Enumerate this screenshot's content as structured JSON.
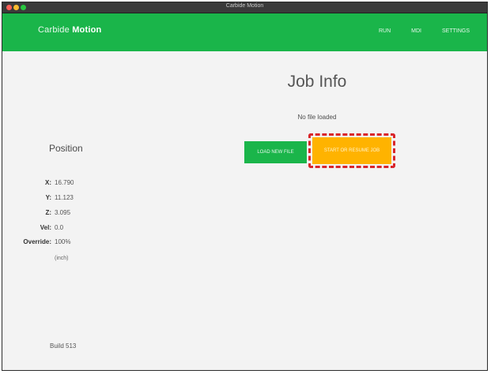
{
  "window": {
    "title": "Carbide Motion"
  },
  "nav": {
    "brand_prefix": "Carbide",
    "brand_strong": "Motion",
    "links": [
      "RUN",
      "MDI",
      "SETTINGS"
    ]
  },
  "job": {
    "title": "Job Info",
    "status": "No file loaded",
    "load_button": "LOAD NEW FILE",
    "resume_button": "START OR RESUME JOB"
  },
  "position": {
    "title": "Position",
    "rows": [
      {
        "label": "X:",
        "value": "16.790"
      },
      {
        "label": "Y:",
        "value": "11.123"
      },
      {
        "label": "Z:",
        "value": "3.095"
      },
      {
        "label": "Vel:",
        "value": "0.0"
      },
      {
        "label": "Override:",
        "value": "100%"
      }
    ],
    "units": "(inch)"
  },
  "footer": {
    "build": "Build 513"
  },
  "colors": {
    "brand_green": "#1ab54a",
    "resume_orange": "#ffb300",
    "highlight_red": "#d9262b"
  }
}
